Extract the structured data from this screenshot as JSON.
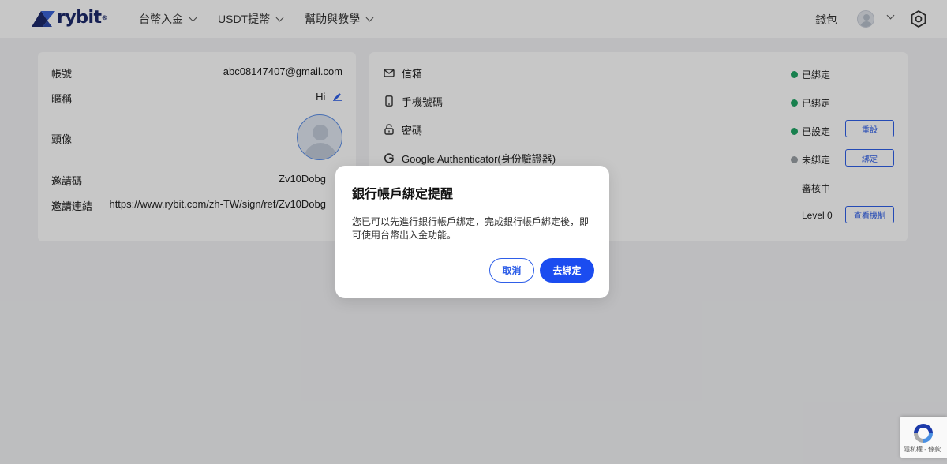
{
  "header": {
    "logo_text": "rybit",
    "logo_reg": "®",
    "nav": [
      {
        "label": "台幣入金"
      },
      {
        "label": "USDT提幣"
      },
      {
        "label": "幫助與教學"
      }
    ],
    "wallet_label": "錢包"
  },
  "profile": {
    "account_label": "帳號",
    "account_value": "abc08147407@gmail.com",
    "nickname_label": "暱稱",
    "nickname_value": "Hi",
    "avatar_label": "頭像",
    "invite_code_label": "邀請碼",
    "invite_code_value": "Zv10Dobg",
    "invite_link_label": "邀請連結",
    "invite_link_value": "https://www.rybit.com/zh-TW/sign/ref/Zv10Dobg"
  },
  "security": {
    "email_label": "信箱",
    "email_status": "已綁定",
    "phone_label": "手機號碼",
    "phone_status": "已綁定",
    "password_label": "密碼",
    "password_status": "已設定",
    "password_button": "重設",
    "google_label": "Google Authenticator(身份驗證器)",
    "google_status": "未綁定",
    "google_button": "綁定",
    "review_status": "審核中",
    "level_status": "Level 0",
    "level_button": "查看機制"
  },
  "modal": {
    "title": "銀行帳戶綁定提醒",
    "body": "您已可以先進行銀行帳戶綁定，完成銀行帳戶綁定後，即可使用台幣出入金功能。",
    "cancel_label": "取消",
    "confirm_label": "去綁定"
  },
  "recaptcha": {
    "text": "隱私權 - 條款"
  },
  "colors": {
    "brand_blue": "#1b4cf0",
    "logo_navy": "#1d2a6b",
    "status_green": "#1fa464",
    "status_gray": "#9aa0a6"
  }
}
